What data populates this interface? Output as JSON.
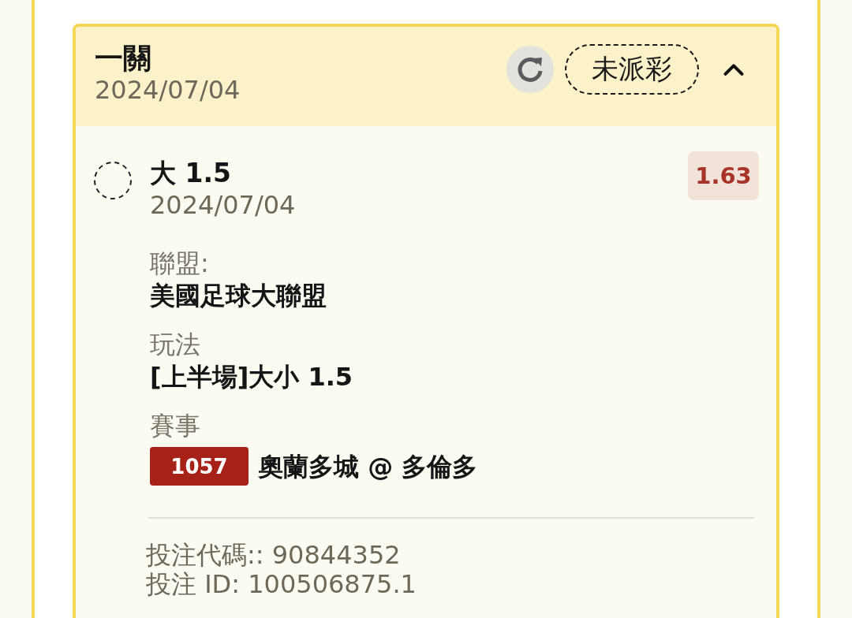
{
  "bet": {
    "title": "一關",
    "date": "2024/07/04",
    "status": "未派彩",
    "expanded": true
  },
  "selection": {
    "pick": "大 1.5",
    "date": "2024/07/04",
    "odds": "1.63",
    "details": [
      {
        "label": "聯盟:",
        "value": "美國足球大聯盟"
      },
      {
        "label": "玩法",
        "value": "[上半場]大小 1.5"
      },
      {
        "label": "賽事",
        "match_code": "1057",
        "value": "奧蘭多城 @ 多倫多"
      }
    ]
  },
  "footer": [
    "投注代碼:: 90844352",
    "投注 ID: 100506875.1"
  ]
}
